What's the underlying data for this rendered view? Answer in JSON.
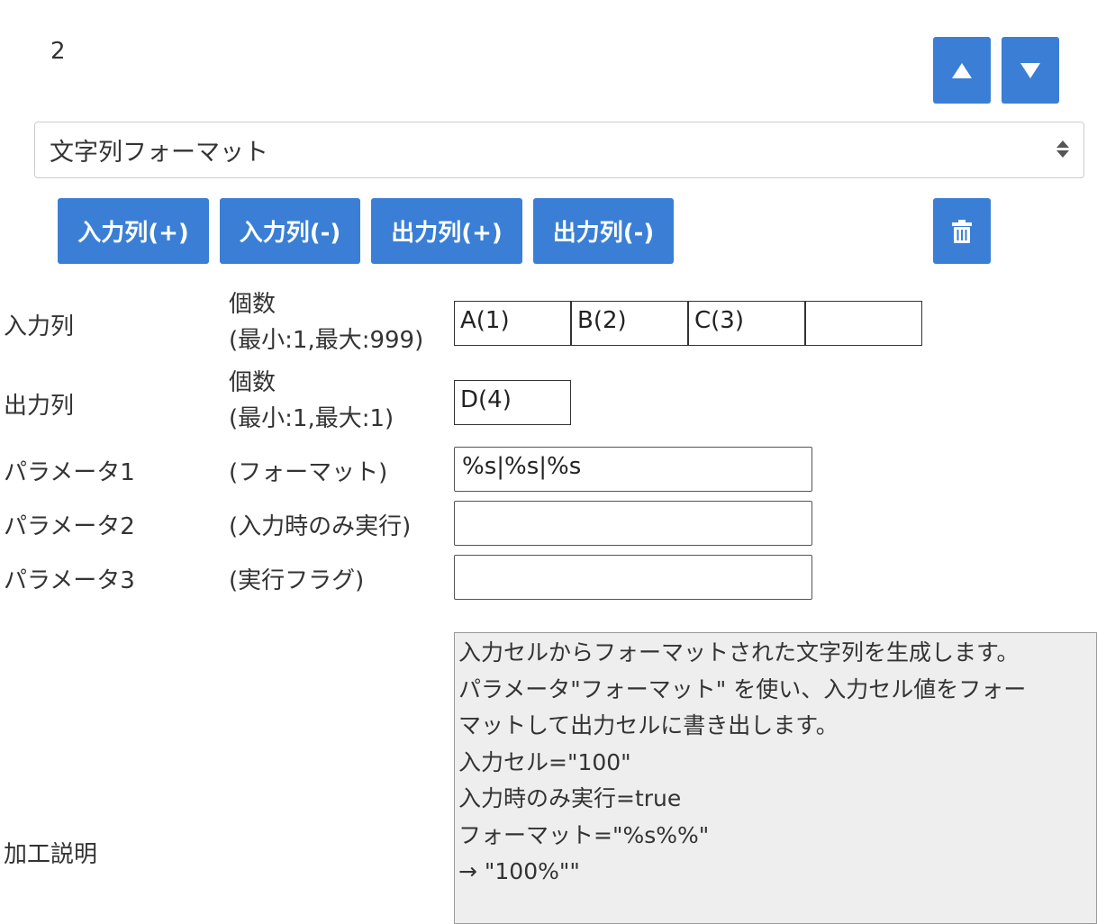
{
  "step": {
    "number": "2"
  },
  "processor_select": {
    "value": "文字列フォーマット"
  },
  "buttons": {
    "input_add": "入力列(+)",
    "input_remove": "入力列(-)",
    "output_add": "出力列(+)",
    "output_remove": "出力列(-)"
  },
  "rows": {
    "input": {
      "label": "入力列",
      "count_title": "個数",
      "count_range": "(最小:1,最大:999)",
      "cells": [
        "A(1)",
        "B(2)",
        "C(3)",
        ""
      ]
    },
    "output": {
      "label": "出力列",
      "count_title": "個数",
      "count_range": "(最小:1,最大:1)",
      "cells": [
        "D(4)"
      ]
    },
    "param1": {
      "label": "パラメータ1",
      "desc": "(フォーマット)",
      "value": "%s|%s|%s"
    },
    "param2": {
      "label": "パラメータ2",
      "desc": "(入力時のみ実行)",
      "value": ""
    },
    "param3": {
      "label": "パラメータ3",
      "desc": "(実行フラグ)",
      "value": ""
    }
  },
  "description": {
    "label": "加工説明",
    "lines": [
      "入力セルからフォーマットされた文字列を生成します。",
      "パラメータ\"フォーマット\" を使い、入力セル値をフォー",
      "マットして出力セルに書き出します。",
      "入力セル=\"100\"",
      "入力時のみ実行=true",
      "フォーマット=\"%s%%\"",
      "→ \"100%\"\""
    ]
  },
  "icons": {
    "up": "arrow-up-icon",
    "down": "arrow-down-icon",
    "delete": "trash-icon"
  },
  "colors": {
    "primary_button": "#3a7fd5",
    "description_bg": "#eeeeee"
  }
}
